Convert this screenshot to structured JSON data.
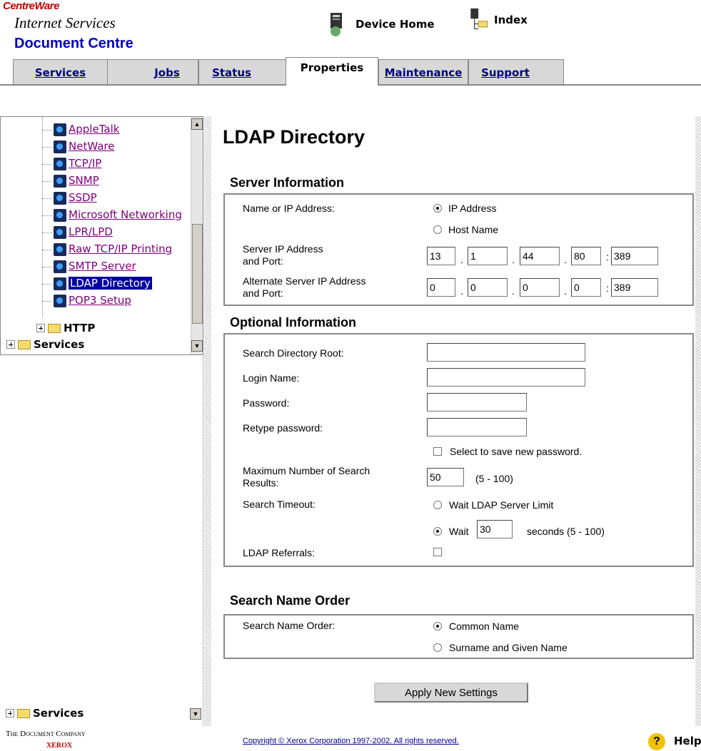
{
  "header": {
    "brand_line1": "CentreWare",
    "brand_line2": "Internet Services",
    "brand_line3": "Document Centre",
    "device_home": "Device Home",
    "index": "Index"
  },
  "tabs": [
    {
      "label": "Services",
      "active": false
    },
    {
      "label": "Jobs",
      "active": false
    },
    {
      "label": "Status",
      "active": false
    },
    {
      "label": "Properties",
      "active": true
    },
    {
      "label": "Maintenance",
      "active": false
    },
    {
      "label": "Support",
      "active": false
    }
  ],
  "tree": {
    "items": [
      "AppleTalk",
      "NetWare",
      "TCP/IP",
      "SNMP",
      "SSDP",
      "Microsoft Networking",
      "LPR/LPD",
      "Raw TCP/IP Printing",
      "SMTP Server",
      "LDAP Directory",
      "POP3 Setup"
    ],
    "selected": "LDAP Directory",
    "folder_http": "HTTP",
    "folder_services": "Services",
    "folder_services_bottom": "Services"
  },
  "page": {
    "title": "LDAP Directory",
    "server_info": {
      "heading": "Server Information",
      "name_or_ip_label": "Name or IP Address:",
      "opt_ip": "IP Address",
      "opt_host": "Host Name",
      "server_ip_label": "Server IP Address\nand Port:",
      "server_ip": [
        "13",
        "1",
        "44",
        "80"
      ],
      "server_port": "389",
      "alt_ip_label": "Alternate Server IP Address\nand Port:",
      "alt_ip": [
        "0",
        "0",
        "0",
        "0"
      ],
      "alt_port": "389"
    },
    "optional_info": {
      "heading": "Optional Information",
      "search_root_label": "Search Directory Root:",
      "search_root_value": "",
      "login_label": "Login Name:",
      "login_value": "",
      "password_label": "Password:",
      "retype_label": "Retype password:",
      "save_pw_label": "Select to save new password.",
      "max_results_label": "Maximum Number of Search\nResults:",
      "max_results_value": "50",
      "max_results_range": "(5 - 100)",
      "timeout_label": "Search Timeout:",
      "timeout_opt1": "Wait LDAP Server Limit",
      "timeout_opt2_prefix": "Wait",
      "timeout_value": "30",
      "timeout_suffix": "seconds (5 - 100)",
      "referrals_label": "LDAP Referrals:"
    },
    "search_order": {
      "heading": "Search Name Order",
      "label": "Search Name Order:",
      "opt1": "Common Name",
      "opt2": "Surname and Given Name"
    },
    "apply_button": "Apply New Settings"
  },
  "footer": {
    "company": "The Document Company",
    "xerox": "XEROX",
    "copyright": "Copyright © Xerox Corporation 1997-2002. All rights reserved.",
    "help": "Help"
  }
}
